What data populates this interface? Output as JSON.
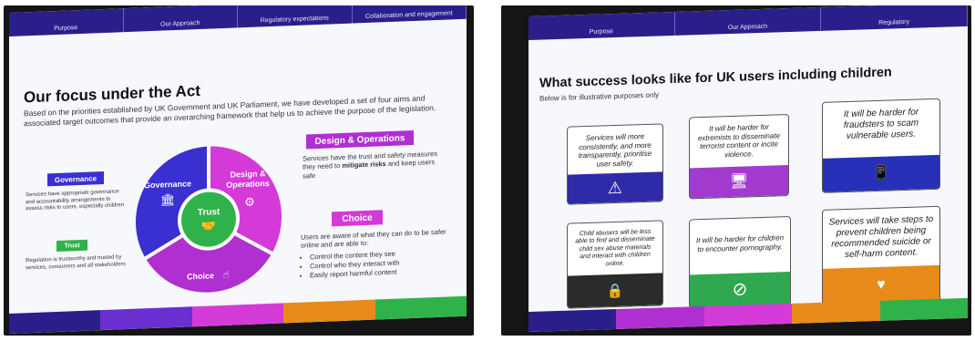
{
  "left_slide": {
    "nav": [
      "Purpose",
      "Our Approach",
      "Regulatory expectations",
      "Collaboration and engagement"
    ],
    "title": "Our focus under the Act",
    "intro": "Based on the priorities established by UK Government and UK Parliament, we have developed a set of four aims and associated target outcomes that provide an overarching framework that help us to achieve the purpose of the legislation.",
    "governance": {
      "label": "Governance",
      "text": "Services have appropriate governance and accountability arrangements to assess risks to users, especially children"
    },
    "trust": {
      "label": "Trust",
      "text": "Regulation is trustworthy and trusted by services, consumers and all stakeholders"
    },
    "design": {
      "label": "Design & Operations",
      "text_a": "Services have the trust and safety measures they need to ",
      "text_b": "mitigate risks",
      "text_c": " and keep users safe"
    },
    "choice": {
      "label": "Choice",
      "text": "Users are aware of what they can do to be safer online and are able to:",
      "bullets": [
        "Control the content they see",
        "Control who they interact with",
        "Easily report harmful content"
      ]
    },
    "wheel": {
      "center": "Trust",
      "seg_governance": "Governance",
      "seg_design_1": "Design &",
      "seg_design_2": "Operations",
      "seg_choice": "Choice"
    }
  },
  "right_slide": {
    "nav": [
      "Purpose",
      "Our Approach",
      "Regulatory"
    ],
    "title": "What success looks like for UK users including children",
    "subtitle": "Below is for illustrative purposes only",
    "cards": [
      {
        "text": "Services will more consistently, and more transparently, prioritise user safety.",
        "color": "#2f2aa8",
        "icon": "warning-icon"
      },
      {
        "text": "It will be harder for extremists to disseminate terrorist content or incite violence.",
        "color": "#a23ad0",
        "icon": "computer-users-icon"
      },
      {
        "text": "It will be harder for fraudsters to scam vulnerable users.",
        "color": "#2830b8",
        "icon": "bank-phone-icon"
      },
      {
        "text": "Child abusers will be less able to find and disseminate child sex abuse materials and interact with children online.",
        "color": "#2b2b2b",
        "icon": "locked-computer-icon"
      },
      {
        "text": "It will be harder for children to encounter pornography.",
        "color": "#2fa84f",
        "icon": "prohibited-icon"
      },
      {
        "text": "Services will take steps to prevent children being recommended suicide or self-harm content.",
        "color": "#e88a1a",
        "icon": "heart-hand-icon"
      }
    ]
  },
  "colors": {
    "navy": "#2a1f8a",
    "blue": "#3a2fd0",
    "magenta": "#d43ad8",
    "green": "#2fb24a",
    "orange": "#e88a1a"
  }
}
